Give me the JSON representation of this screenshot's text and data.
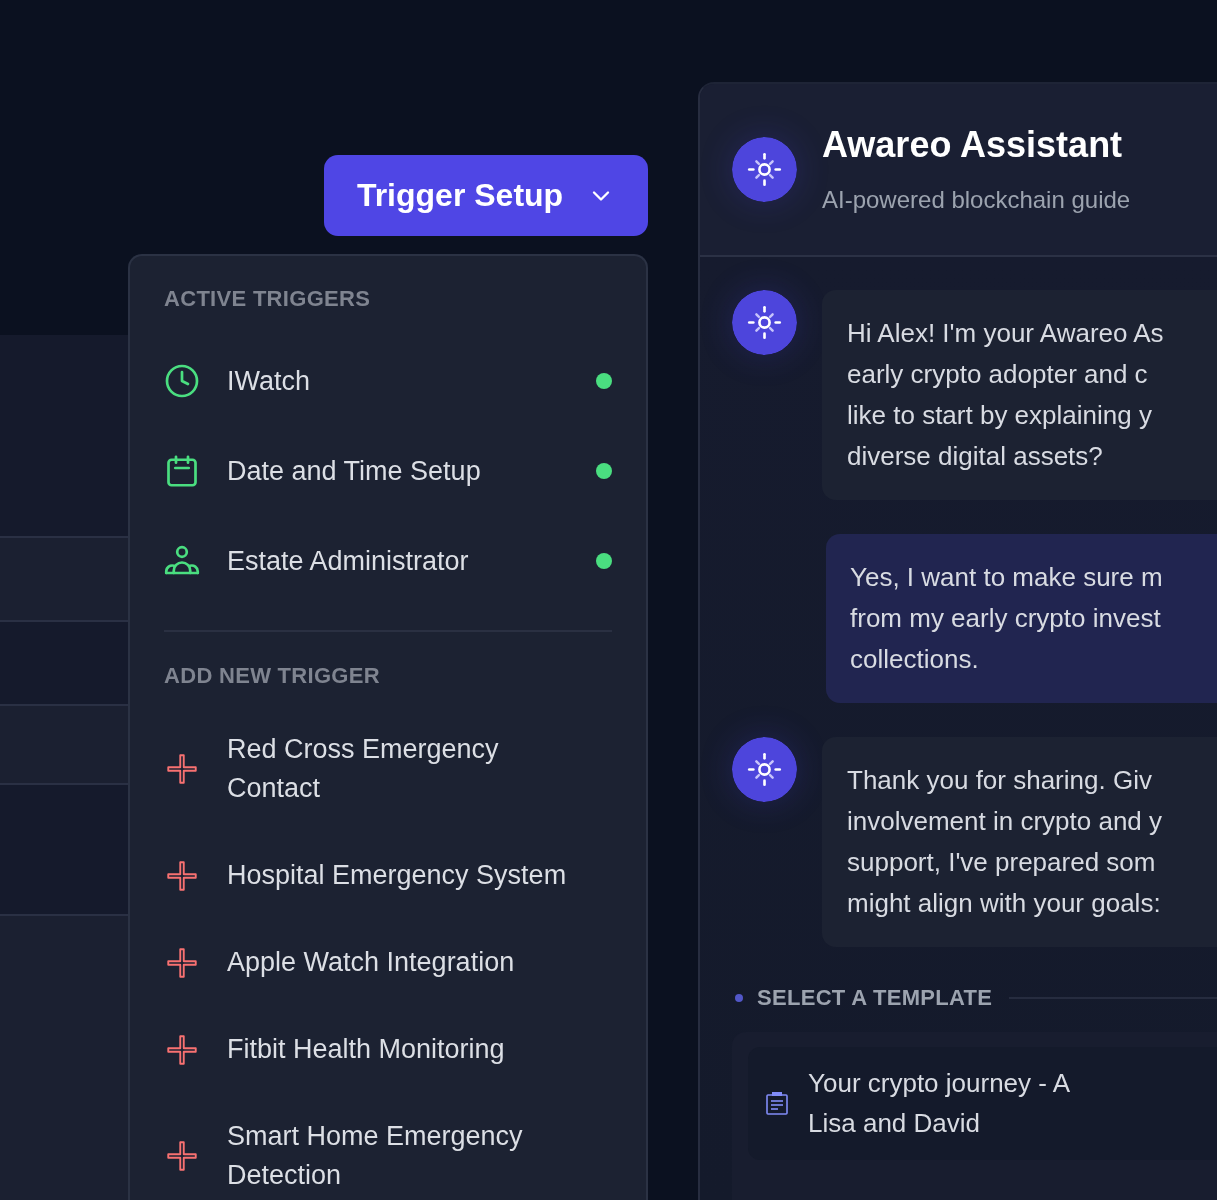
{
  "trigger_button": {
    "label": "Trigger Setup"
  },
  "dropdown": {
    "active_heading": "ACTIVE TRIGGERS",
    "active_triggers": [
      {
        "kind": "watch",
        "label": "IWatch",
        "active": true
      },
      {
        "kind": "schedule",
        "label": "Date and Time Setup",
        "active": true
      },
      {
        "kind": "contact",
        "label": "Estate Administrator",
        "active": true
      }
    ],
    "add_heading": "ADD NEW TRIGGER",
    "new_triggers": [
      {
        "label": "Red Cross Emergency Contact"
      },
      {
        "label": "Hospital Emergency System"
      },
      {
        "label": "Apple Watch Integration"
      },
      {
        "label": "Fitbit Health Monitoring"
      },
      {
        "label": "Smart Home Emergency Detection"
      }
    ]
  },
  "assistant": {
    "name": "Awareo Assistant",
    "subtitle": "AI-powered blockchain guide"
  },
  "messages": [
    {
      "kind": "assistant",
      "lines": [
        "Hi Alex! I'm your Awareo As",
        "early crypto adopter and c",
        "like to start by explaining y",
        "diverse digital assets?"
      ]
    },
    {
      "kind": "user",
      "lines": [
        "Yes, I want to make sure m",
        "from my early crypto invest",
        "collections."
      ]
    },
    {
      "kind": "assistant",
      "lines": [
        "Thank you for sharing. Giv",
        "involvement in crypto and y",
        "support, I've prepared som",
        "might align with your goals:"
      ]
    }
  ],
  "templates": {
    "heading": "SELECT A TEMPLATE",
    "items": [
      {
        "lines": [
          "Your crypto journey - A",
          "Lisa and David"
        ]
      }
    ]
  }
}
